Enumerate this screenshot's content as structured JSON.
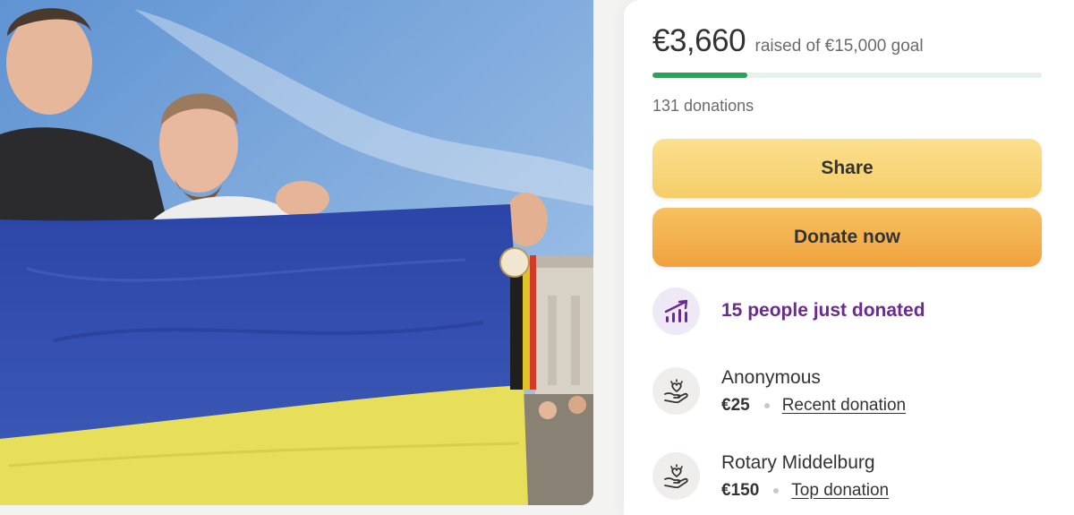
{
  "summary": {
    "amount_raised": "€3,660",
    "goal_text": "raised of €15,000 goal",
    "progress_fraction": 0.244,
    "donation_count": "131 donations"
  },
  "actions": {
    "share_label": "Share",
    "donate_label": "Donate now"
  },
  "activity": {
    "recent_text": "15 people just donated",
    "icon": "trending-up-icon"
  },
  "donations": [
    {
      "name": "Anonymous",
      "amount": "€25",
      "tag": "Recent donation",
      "icon": "heart-hand-icon"
    },
    {
      "name": "Rotary Middelburg",
      "amount": "€150",
      "tag": "Top donation",
      "icon": "heart-hand-icon"
    }
  ],
  "colors": {
    "progress": "#2f9f5b",
    "share_button": "#f5cd68",
    "donate_button": "#f0a23e",
    "accent_purple": "#6b2a90"
  }
}
